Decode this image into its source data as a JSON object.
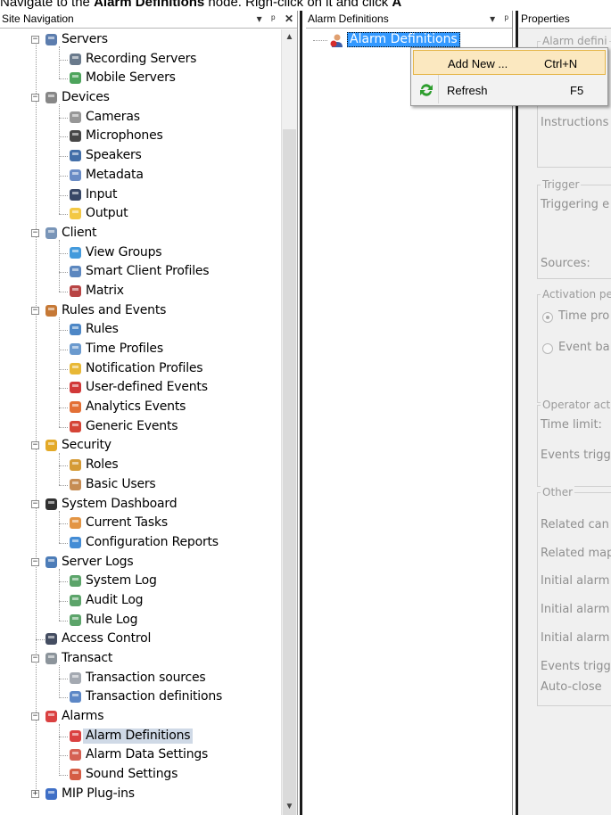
{
  "instruction": {
    "prefix": "Navigate to the ",
    "node": "Alarm Definitions",
    "middle": " node. Righ-click on it and click ",
    "suffix": "A"
  },
  "site_nav": {
    "title": "Site Navigation",
    "items": [
      {
        "label": "Servers",
        "level": 0,
        "icon": "server-icon",
        "expander": "minus"
      },
      {
        "label": "Recording Servers",
        "level": 1,
        "icon": "recording-server-icon"
      },
      {
        "label": "Mobile Servers",
        "level": 1,
        "icon": "mobile-server-icon"
      },
      {
        "label": "Devices",
        "level": 0,
        "icon": "devices-icon",
        "expander": "minus"
      },
      {
        "label": "Cameras",
        "level": 1,
        "icon": "camera-icon"
      },
      {
        "label": "Microphones",
        "level": 1,
        "icon": "microphone-icon"
      },
      {
        "label": "Speakers",
        "level": 1,
        "icon": "speaker-icon"
      },
      {
        "label": "Metadata",
        "level": 1,
        "icon": "metadata-icon"
      },
      {
        "label": "Input",
        "level": 1,
        "icon": "input-icon"
      },
      {
        "label": "Output",
        "level": 1,
        "icon": "output-icon"
      },
      {
        "label": "Client",
        "level": 0,
        "icon": "client-icon",
        "expander": "minus"
      },
      {
        "label": "View Groups",
        "level": 1,
        "icon": "view-groups-icon"
      },
      {
        "label": "Smart Client Profiles",
        "level": 1,
        "icon": "smart-client-profiles-icon"
      },
      {
        "label": "Matrix",
        "level": 1,
        "icon": "matrix-icon"
      },
      {
        "label": "Rules and Events",
        "level": 0,
        "icon": "rules-and-events-icon",
        "expander": "minus"
      },
      {
        "label": "Rules",
        "level": 1,
        "icon": "rules-icon"
      },
      {
        "label": "Time Profiles",
        "level": 1,
        "icon": "time-profiles-icon"
      },
      {
        "label": "Notification Profiles",
        "level": 1,
        "icon": "notification-profiles-icon"
      },
      {
        "label": "User-defined Events",
        "level": 1,
        "icon": "user-defined-events-icon"
      },
      {
        "label": "Analytics Events",
        "level": 1,
        "icon": "analytics-events-icon"
      },
      {
        "label": "Generic Events",
        "level": 1,
        "icon": "generic-events-icon"
      },
      {
        "label": "Security",
        "level": 0,
        "icon": "security-icon",
        "expander": "minus"
      },
      {
        "label": "Roles",
        "level": 1,
        "icon": "roles-icon"
      },
      {
        "label": "Basic Users",
        "level": 1,
        "icon": "basic-users-icon"
      },
      {
        "label": "System Dashboard",
        "level": 0,
        "icon": "system-dashboard-icon",
        "expander": "minus"
      },
      {
        "label": "Current Tasks",
        "level": 1,
        "icon": "current-tasks-icon"
      },
      {
        "label": "Configuration Reports",
        "level": 1,
        "icon": "configuration-reports-icon"
      },
      {
        "label": "Server Logs",
        "level": 0,
        "icon": "server-logs-icon",
        "expander": "minus"
      },
      {
        "label": "System Log",
        "level": 1,
        "icon": "log-icon"
      },
      {
        "label": "Audit Log",
        "level": 1,
        "icon": "log-icon"
      },
      {
        "label": "Rule Log",
        "level": 1,
        "icon": "log-icon"
      },
      {
        "label": "Access Control",
        "level": 0,
        "icon": "access-control-icon"
      },
      {
        "label": "Transact",
        "level": 0,
        "icon": "transact-icon",
        "expander": "minus"
      },
      {
        "label": "Transaction sources",
        "level": 1,
        "icon": "transaction-sources-icon"
      },
      {
        "label": "Transaction definitions",
        "level": 1,
        "icon": "transaction-definitions-icon"
      },
      {
        "label": "Alarms",
        "level": 0,
        "icon": "alarms-icon",
        "expander": "minus"
      },
      {
        "label": "Alarm Definitions",
        "level": 1,
        "icon": "alarm-definitions-icon",
        "selected": true
      },
      {
        "label": "Alarm Data Settings",
        "level": 1,
        "icon": "alarm-data-settings-icon"
      },
      {
        "label": "Sound Settings",
        "level": 1,
        "icon": "sound-settings-icon"
      },
      {
        "label": "MIP Plug-ins",
        "level": 0,
        "icon": "mip-plugins-icon",
        "expander": "plus"
      }
    ]
  },
  "definitions_pane": {
    "title": "Alarm Definitions",
    "root_label": "Alarm Definitions"
  },
  "context_menu": {
    "items": [
      {
        "label": "Add New ...",
        "shortcut": "Ctrl+N",
        "highlighted": true
      },
      {
        "label": "Refresh",
        "shortcut": "F5",
        "icon": "refresh-icon"
      }
    ]
  },
  "properties": {
    "title": "Properties",
    "group_alarm": "Alarm defini",
    "instructions": "Instructions",
    "group_trigger": "Trigger",
    "triggering": "Triggering e",
    "sources": "Sources:",
    "group_activation": "Activation pe",
    "time_profile": "Time pro",
    "event_based": "Event ba",
    "group_operator": "Operator act",
    "time_limit": "Time limit:",
    "events_triggered_1": "Events trigg",
    "group_other": "Other",
    "related_cameras": "Related can",
    "related_map": "Related map",
    "initial_alarm_1": "Initial alarm",
    "initial_alarm_2": "Initial alarm",
    "initial_alarm_3": "Initial alarm",
    "events_triggered_2": "Events trigg",
    "auto_close": "Auto-close"
  },
  "colors": {
    "selection": "#3399ff",
    "menu_highlight": "#fbe8c0",
    "tree_selection": "#cfd9e6"
  }
}
